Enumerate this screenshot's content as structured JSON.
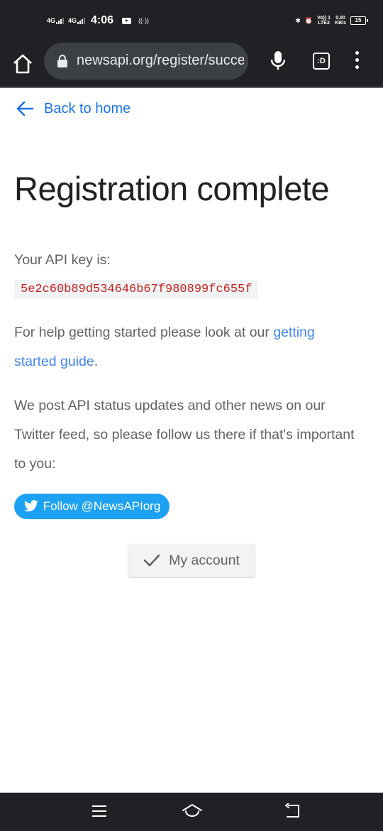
{
  "status_bar": {
    "network_1": "4G",
    "network_2": "4G",
    "time": "4:06",
    "volte_top": "Vo)) 1",
    "volte_bottom": "LTE2",
    "speed_top": "0.00",
    "speed_bottom": "KB/s",
    "battery": "15"
  },
  "browser": {
    "url": "newsapi.org/register/success",
    "tabs_label": ":D"
  },
  "page": {
    "back_label": "Back to home",
    "title": "Registration complete",
    "api_key_label": "Your API key is:",
    "api_key": "5e2c60b89d534646b67f980899fc655f",
    "help_text_before": "For help getting started please look at our ",
    "help_link": "getting started guide",
    "help_text_after": ".",
    "status_text": "We post API status updates and other news on our Twitter feed, so please follow us there if that's important to you:",
    "twitter_button": "Follow @NewsAPIorg",
    "account_button": "My account"
  },
  "colors": {
    "link": "#1a73e8",
    "twitter": "#1da1f2",
    "api_key_text": "#c5221f",
    "chrome_dark": "#202124"
  }
}
